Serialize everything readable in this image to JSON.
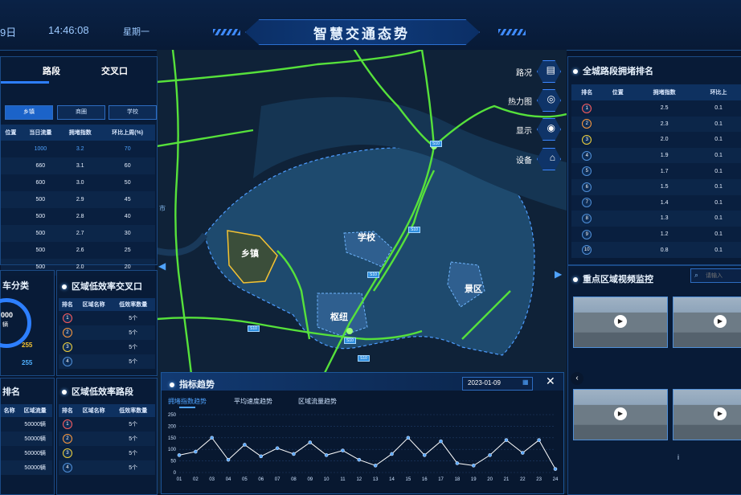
{
  "header": {
    "date": "9日",
    "time": "14:46:08",
    "weekday": "星期一",
    "title": "智慧交通态势"
  },
  "left": {
    "tabs": [
      "路段",
      "交叉口"
    ],
    "filters": [
      "乡镇",
      "商圈",
      "学校"
    ],
    "table": {
      "headers": [
        "位置",
        "当日流量",
        "拥堵指数",
        "环比上周(%)"
      ],
      "rows": [
        [
          "",
          "1000",
          "3.2",
          "70"
        ],
        [
          "",
          "660",
          "3.1",
          "60"
        ],
        [
          "",
          "600",
          "3.0",
          "50"
        ],
        [
          "",
          "500",
          "2.9",
          "45"
        ],
        [
          "",
          "500",
          "2.8",
          "40"
        ],
        [
          "",
          "500",
          "2.7",
          "30"
        ],
        [
          "",
          "500",
          "2.6",
          "25"
        ],
        [
          "",
          "500",
          "2.0",
          "20"
        ]
      ]
    },
    "category_title": "车分类",
    "gauge_value": "000",
    "gauge_unit": "辆",
    "gauge_stats": [
      "255",
      "255"
    ],
    "low_cross": {
      "title": "区域低效率交叉口",
      "headers": [
        "排名",
        "区域名称",
        "低效率数量"
      ],
      "rows": [
        [
          "1",
          "",
          "5个"
        ],
        [
          "2",
          "",
          "5个"
        ],
        [
          "3",
          "",
          "5个"
        ],
        [
          "4",
          "",
          "5个"
        ]
      ]
    },
    "rank_title": "排名",
    "flow_table": {
      "headers": [
        "名称",
        "区域流量"
      ],
      "rows": [
        [
          "",
          "50000辆"
        ],
        [
          "",
          "50000辆"
        ],
        [
          "",
          "50000辆"
        ],
        [
          "",
          "50000辆"
        ]
      ]
    },
    "low_road": {
      "title": "区域低效率路段",
      "headers": [
        "排名",
        "区域名称",
        "低效率数量"
      ],
      "rows": [
        [
          "1",
          "",
          "5个"
        ],
        [
          "2",
          "",
          "5个"
        ],
        [
          "3",
          "",
          "5个"
        ],
        [
          "4",
          "",
          "5个"
        ]
      ]
    }
  },
  "map": {
    "labels": [
      "乡镇",
      "学校",
      "枢纽",
      "景区"
    ],
    "city_label": "市",
    "road_tags": [
      "S10",
      "S10",
      "S10",
      "S10",
      "S10",
      "S10"
    ]
  },
  "tools": [
    {
      "label": "路况",
      "icon": "traffic-light-icon",
      "glyph": "▤"
    },
    {
      "label": "热力图",
      "icon": "heatmap-icon",
      "glyph": "◎"
    },
    {
      "label": "显示",
      "icon": "eye-icon",
      "glyph": "◉"
    },
    {
      "label": "设备",
      "icon": "device-icon",
      "glyph": "⌂"
    }
  ],
  "right": {
    "ranking_title": "全城路段拥堵排名",
    "ranking_headers": [
      "排名",
      "位置",
      "拥堵指数",
      "环比上"
    ],
    "ranking_rows": [
      [
        "1",
        "",
        "2.5",
        "0.1"
      ],
      [
        "2",
        "",
        "2.3",
        "0.1"
      ],
      [
        "3",
        "",
        "2.0",
        "0.1"
      ],
      [
        "4",
        "",
        "1.9",
        "0.1"
      ],
      [
        "5",
        "",
        "1.7",
        "0.1"
      ],
      [
        "6",
        "",
        "1.5",
        "0.1"
      ],
      [
        "7",
        "",
        "1.4",
        "0.1"
      ],
      [
        "8",
        "",
        "1.3",
        "0.1"
      ],
      [
        "9",
        "",
        "1.2",
        "0.1"
      ],
      [
        "10",
        "",
        "0.8",
        "0.1"
      ]
    ],
    "video_title": "重点区域视频监控",
    "search_placeholder": "请输入",
    "page_marker": "i"
  },
  "trend": {
    "title": "指标趋势",
    "date": "2023-01-09",
    "tabs": [
      "拥堵指数趋势",
      "平均速度趋势",
      "区域流量趋势"
    ]
  },
  "chart_data": {
    "type": "line",
    "title": "",
    "xlabel": "",
    "ylabel": "",
    "x": [
      "01",
      "02",
      "03",
      "04",
      "05",
      "06",
      "07",
      "08",
      "09",
      "10",
      "11",
      "12",
      "13",
      "14",
      "15",
      "16",
      "17",
      "18",
      "19",
      "20",
      "21",
      "22",
      "23",
      "24"
    ],
    "ylim": [
      0,
      250
    ],
    "yticks": [
      0,
      50,
      100,
      150,
      200,
      250
    ],
    "series": [
      {
        "values": [
          75,
          90,
          150,
          55,
          120,
          70,
          105,
          80,
          130,
          75,
          95,
          55,
          30,
          80,
          150,
          75,
          135,
          40,
          30,
          75,
          140,
          85,
          140,
          15
        ]
      }
    ],
    "colors": {
      "line": "#ffffff",
      "point": "#5aa8ff",
      "grid": "#1f3d66"
    }
  }
}
